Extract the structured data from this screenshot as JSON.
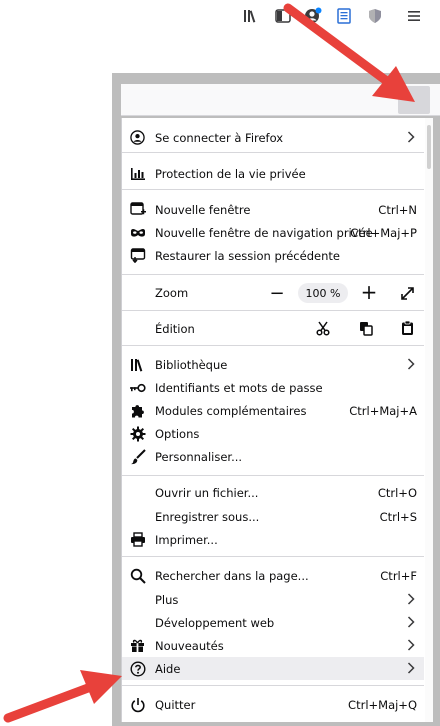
{
  "menu": {
    "sign_in": "Se connecter à Firefox",
    "privacy": "Protection de la vie privée",
    "new_window": {
      "label": "Nouvelle fenêtre",
      "shortcut": "Ctrl+N"
    },
    "new_private": {
      "label": "Nouvelle fenêtre de navigation privée",
      "shortcut": "Ctrl+Maj+P"
    },
    "restore": "Restaurer la session précédente",
    "zoom": {
      "label": "Zoom",
      "minus": "−",
      "value": "100 %",
      "plus": "+"
    },
    "edit": "Édition",
    "library": "Bibliothèque",
    "logins": "Identifiants et mots de passe",
    "addons": {
      "label": "Modules complémentaires",
      "shortcut": "Ctrl+Maj+A"
    },
    "options": "Options",
    "customize": "Personnaliser...",
    "open_file": {
      "label": "Ouvrir un fichier...",
      "shortcut": "Ctrl+O"
    },
    "save_as": {
      "label": "Enregistrer sous...",
      "shortcut": "Ctrl+S"
    },
    "print": "Imprimer...",
    "find": {
      "label": "Rechercher dans la page...",
      "shortcut": "Ctrl+F"
    },
    "more": "Plus",
    "webdev": "Développement web",
    "whatsnew": "Nouveautés",
    "help": "Aide",
    "quit": {
      "label": "Quitter",
      "shortcut": "Ctrl+Maj+Q"
    }
  },
  "icons": {
    "toolbar": [
      "library-icon",
      "sidebar-icon",
      "account-icon",
      "reader-icon",
      "shield-icon",
      "hamburger-menu-icon"
    ],
    "annotation": "red-arrow"
  },
  "colors": {
    "arrow": "#e8413b",
    "accent": "#0a84ff",
    "hover": "#ededf0"
  }
}
